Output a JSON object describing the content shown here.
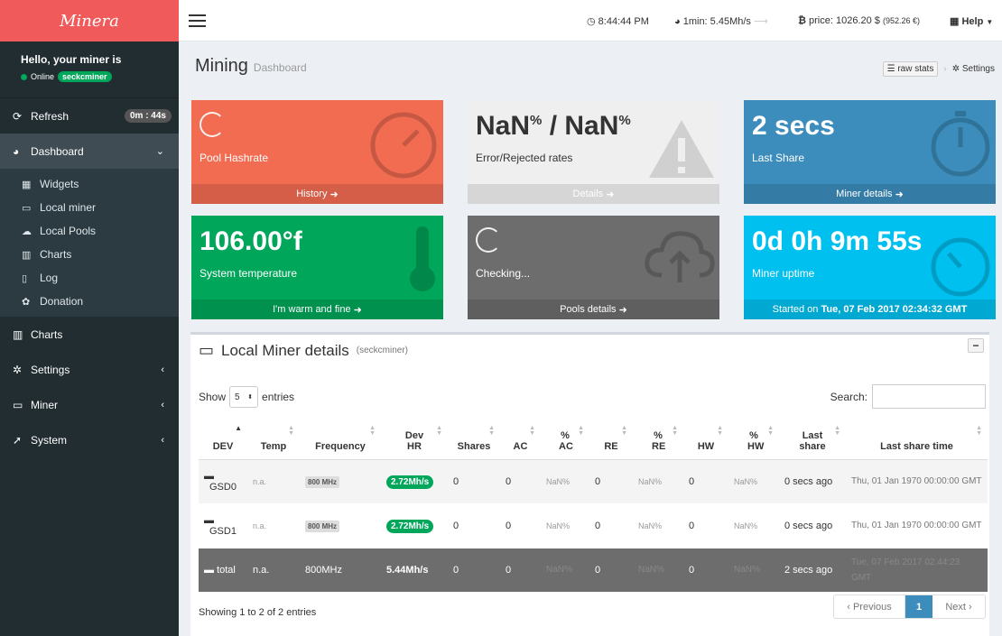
{
  "brand": "Minera",
  "user": {
    "hello": "Hello, your miner is",
    "status": "Online",
    "name": "seckcminer"
  },
  "sidebar": {
    "refresh": {
      "label": "Refresh",
      "badge": "0m : 44s"
    },
    "dashboard": {
      "label": "Dashboard"
    },
    "sub": [
      "Widgets",
      "Local miner",
      "Local Pools",
      "Charts",
      "Log",
      "Donation"
    ],
    "charts": "Charts",
    "settings": "Settings",
    "miner": "Miner",
    "system": "System"
  },
  "topbar": {
    "time": "8:44:44 PM",
    "hashrate": "1min: 5.45Mh/s",
    "price": "price: 1026.20 $",
    "price_sub": "(952.26 €)",
    "help": "Help"
  },
  "page": {
    "title": "Mining",
    "subtitle": "Dashboard",
    "raw_stats": "raw stats",
    "settings": "Settings"
  },
  "boxes": {
    "pool": {
      "label": "Pool Hashrate",
      "footer": "History"
    },
    "error": {
      "value": "NaN",
      "unit": "%",
      "sep": " / ",
      "value2": "NaN",
      "unit2": "%",
      "label": "Error/Rejected rates",
      "footer": "Details"
    },
    "share": {
      "value": "2 secs",
      "label": "Last Share",
      "footer": "Miner details"
    },
    "temp": {
      "value": "106.00°f",
      "label": "System temperature",
      "footer": "I'm warm and fine"
    },
    "check": {
      "label": "Checking...",
      "footer": "Pools details"
    },
    "uptime": {
      "value": "0d 0h 9m 55s",
      "label": "Miner uptime",
      "footer_prefix": "Started on ",
      "footer_bold": "Tue, 07 Feb 2017 02:34:32 GMT"
    }
  },
  "panel": {
    "title": "Local Miner details",
    "subtitle": "(seckcminer)",
    "show": "Show",
    "entries_value": "5",
    "entries": "entries",
    "search": "Search:",
    "headers": [
      "DEV",
      "Temp",
      "Frequency",
      "Dev HR",
      "Shares",
      "AC",
      "% AC",
      "RE",
      "% RE",
      "HW",
      "% HW",
      "Last share",
      "Last share time"
    ],
    "rows": [
      {
        "dev": "GSD0",
        "temp": "n.a.",
        "freq": "800 MHz",
        "hr": "2.72Mh/s",
        "shares": "0",
        "ac": "0",
        "pac": "NaN%",
        "re": "0",
        "pre": "NaN%",
        "hw": "0",
        "phw": "NaN%",
        "last": "0 secs ago",
        "time": "Thu, 01 Jan 1970 00:00:00 GMT"
      },
      {
        "dev": "GSD1",
        "temp": "n.a.",
        "freq": "800 MHz",
        "hr": "2.72Mh/s",
        "shares": "0",
        "ac": "0",
        "pac": "NaN%",
        "re": "0",
        "pre": "NaN%",
        "hw": "0",
        "phw": "NaN%",
        "last": "0 secs ago",
        "time": "Thu, 01 Jan 1970 00:00:00 GMT"
      }
    ],
    "total": {
      "dev": "total",
      "temp": "n.a.",
      "freq": "800MHz",
      "hr": "5.44Mh/s",
      "shares": "0",
      "ac": "0",
      "pac": "NaN%",
      "re": "0",
      "pre": "NaN%",
      "hw": "0",
      "phw": "NaN%",
      "last": "2 secs ago",
      "time": "Tue, 07 Feb 2017 02:44:23 GMT"
    },
    "info": "Showing 1 to 2 of 2 entries",
    "pager": {
      "prev": "Previous",
      "page": "1",
      "next": "Next"
    }
  },
  "colors": {
    "brand": "#f05a5a",
    "sidebar": "#222d32",
    "red": "#f26c52",
    "blue": "#3c8dbc",
    "green": "#00a65a",
    "gray": "#6d6d6d",
    "cyan": "#00c0ef"
  }
}
